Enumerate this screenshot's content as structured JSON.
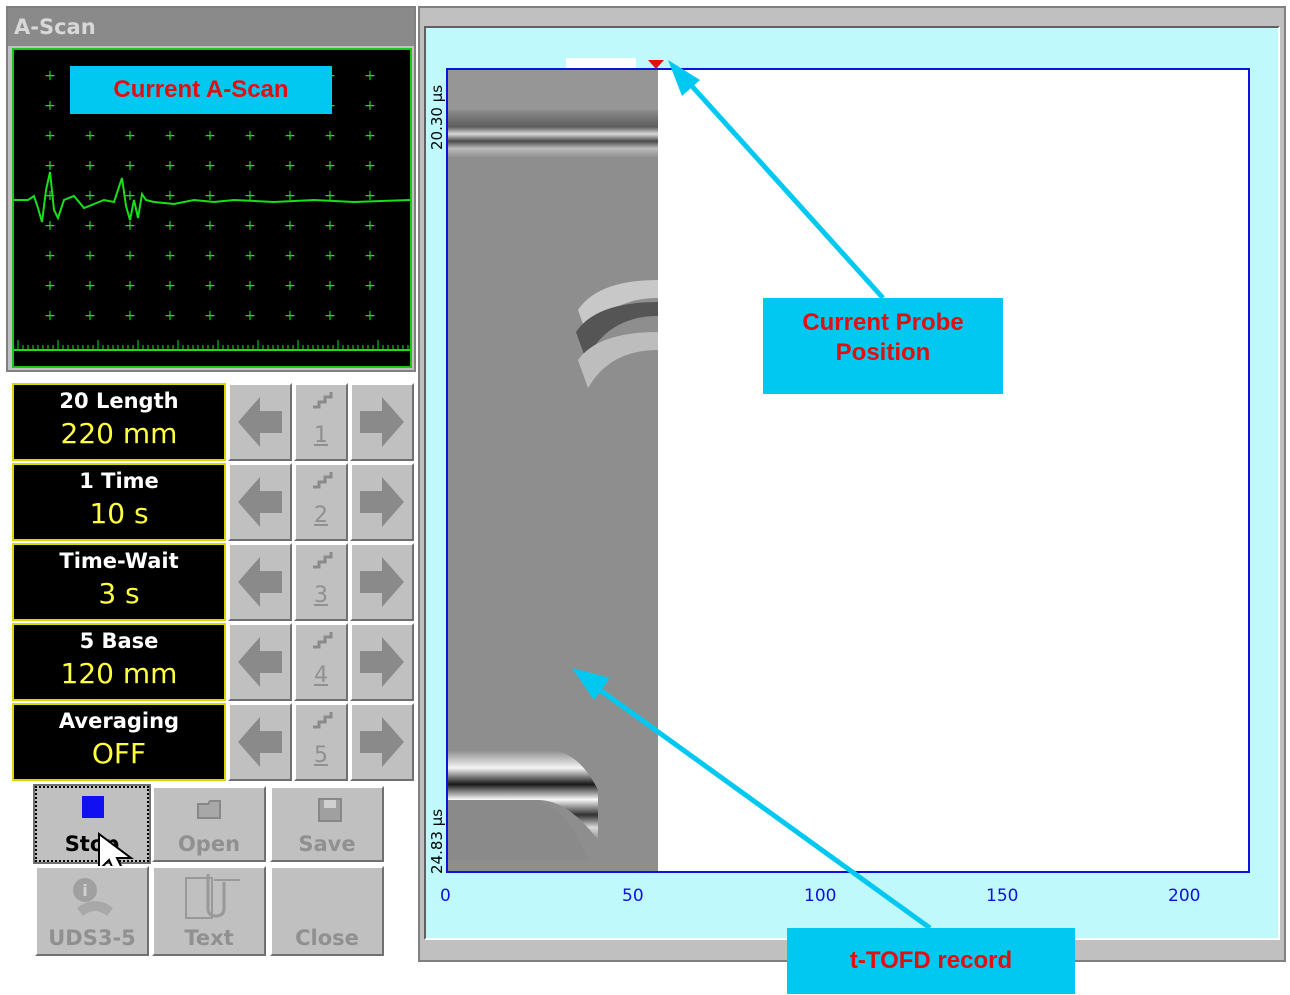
{
  "ascan": {
    "title": "A-Scan",
    "callout": "Current A-Scan"
  },
  "params": [
    {
      "label": "20  Length",
      "value": "220 mm",
      "index": "1"
    },
    {
      "label": "1  Time",
      "value": "10 s",
      "index": "2"
    },
    {
      "label": "Time-Wait",
      "value": "3 s",
      "index": "3"
    },
    {
      "label": "5  Base",
      "value": "120 mm",
      "index": "4"
    },
    {
      "label": "Averaging",
      "value": "OFF",
      "index": "5"
    }
  ],
  "buttons": {
    "stop": "Stop",
    "open": "Open",
    "save": "Save",
    "uds": "UDS3-5",
    "text": "Text",
    "close": "Close"
  },
  "plot": {
    "y_top_label": "20.30 µs",
    "y_bottom_label": "24.83 µs",
    "x_ticks": [
      "0",
      "50",
      "100",
      "150",
      "200"
    ]
  },
  "callouts": {
    "probe": "Current Probe Position",
    "record": "t-TOFD record"
  },
  "colors": {
    "callout_bg": "#00c8f0",
    "callout_text": "#e01010",
    "ascan_trace": "#18e018",
    "axis": "#1010e0",
    "plot_bg": "#bff9fb"
  }
}
